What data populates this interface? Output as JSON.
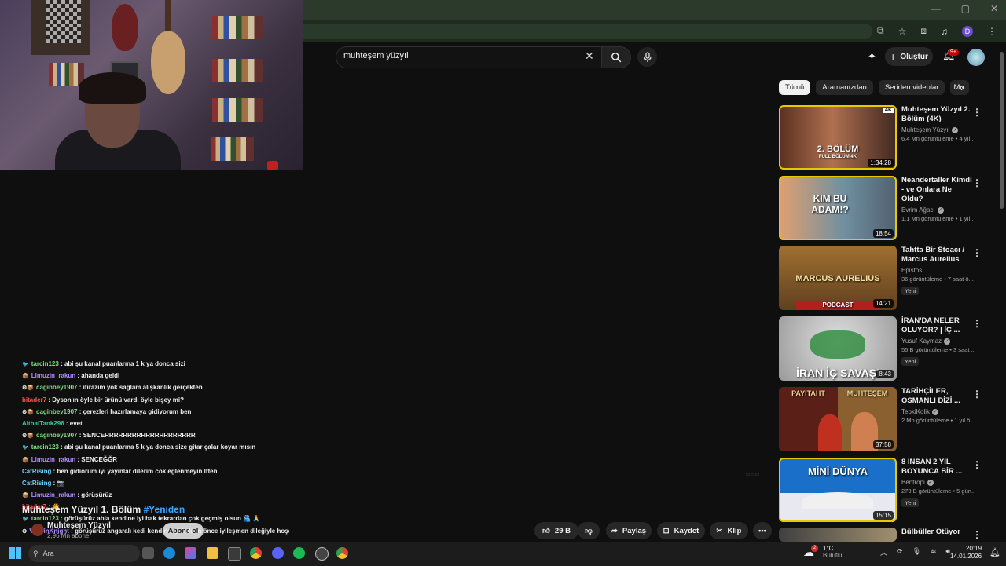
{
  "window": {
    "controls": [
      "—",
      "▢",
      "✕"
    ]
  },
  "browser": {
    "profile_letter": "D"
  },
  "youtube": {
    "search": {
      "query": "muhteşem yüzyıl"
    },
    "create_label": "Oluştur",
    "notif_badge": "9+",
    "chips": [
      "Tümü",
      "Aramanızdan",
      "Seriden videolar",
      "Mu"
    ],
    "recommendations": [
      {
        "title": "Muhteşem Yüzyıl 2. Bölüm (4K)",
        "channel": "Muhteşem Yüzyıl",
        "meta": "6,4 Mn görüntüleme • 4 yıl ...",
        "duration": "1:34:28",
        "thumb_text": "2. BÖLÜM",
        "thumb_sub": "FULL BÖLÜM 4K",
        "new": ""
      },
      {
        "title": "Neandertaller Kimdi - ve Onlara Ne Oldu?",
        "channel": "Evrim Ağacı",
        "meta": "1,1 Mn görüntüleme • 1 yıl ...",
        "duration": "18:54",
        "thumb_text": "KIM BU ADAM!?",
        "thumb_sub": "",
        "new": ""
      },
      {
        "title": "Tahtta Bir Stoacı / Marcus Aurelius",
        "channel": "Epistos",
        "meta": "36 görüntüleme • 7 saat ö...",
        "duration": "14:21",
        "thumb_text": "MARCUS AURELIUS",
        "thumb_sub": "PODCAST",
        "new": "Yeni"
      },
      {
        "title": "İRAN'DA NELER OLUYOR? | İÇ ...",
        "channel": "Yusuf Kaymaz",
        "meta": "55 B görüntüleme • 3 saat ...",
        "duration": "8:43",
        "thumb_text": "İRAN İÇ SAVAŞI",
        "thumb_sub": "",
        "new": "Yeni"
      },
      {
        "title": "TARİHÇİLER, OSMANLI DİZİ ...",
        "channel": "TepkiKolik",
        "meta": "2 Mn görüntüleme • 1 yıl ö...",
        "duration": "37:58",
        "thumb_text": "PAYITAHT",
        "thumb_sub": "MUHTEŞEM",
        "new": ""
      },
      {
        "title": "8 İNSAN 2 YIL BOYUNCA BİR ...",
        "channel": "Bentropi",
        "meta": "279 B görüntüleme • 5 gün...",
        "duration": "15:15",
        "thumb_text": "MİNİ DÜNYA",
        "thumb_sub": "",
        "new": "Yeni"
      },
      {
        "title": "Bülbüller Ötüyor",
        "channel": "",
        "meta": "",
        "duration": "",
        "thumb_text": "",
        "thumb_sub": "",
        "new": ""
      }
    ],
    "video": {
      "title_main": "Muhteşem Yüzyıl 1. Bölüm",
      "title_tag": "#Yeniden",
      "channel": "Muhteşem Yüzyıl",
      "subs": "2,96 Mn abone",
      "subscribe_label": "Abone ol",
      "likes": "29 B",
      "share_label": "Paylaş",
      "save_label": "Kaydet",
      "clip_label": "Klip"
    }
  },
  "chat": [
    {
      "user": "tarcin123",
      "color": "green",
      "emote": "🐦",
      "msg": "abi şu kanal puanlarına 1 k ya donca sizi"
    },
    {
      "user": "Limuzin_rakun",
      "color": "purple",
      "emote": "📦",
      "msg": "ahanda geldi"
    },
    {
      "user": "caginbey1907",
      "color": "green",
      "emote": "⚙📦",
      "msg": "itirazım yok sağlam alışkanlık gerçekten"
    },
    {
      "user": "bitader7",
      "color": "red",
      "emote": "",
      "msg": "Dyson'ın öyle bir ürünü vardı öyle bişey mi?"
    },
    {
      "user": "caginbey1907",
      "color": "green",
      "emote": "⚙📦",
      "msg": "çerezleri hazırlamaya gidiyorum ben"
    },
    {
      "user": "AlthaiTank296",
      "color": "teal",
      "emote": "",
      "msg": "evet"
    },
    {
      "user": "caginbey1907",
      "color": "green",
      "emote": "⚙📦",
      "msg": "SENCERRRRRRRRRRRRRRRRRRRR"
    },
    {
      "user": "tarcin123",
      "color": "green",
      "emote": "🐦",
      "msg": "abi şu kanal puanlarına 5 k ya donca size gitar çalar koyar mısın"
    },
    {
      "user": "Limuzin_rakun",
      "color": "purple",
      "emote": "📦",
      "msg": "SENCEĞĞR"
    },
    {
      "user": "CatRising",
      "color": "cyan",
      "emote": "",
      "msg": "ben gidiorum iyi yayinlar dilerim cok eglenmeyin ltfen"
    },
    {
      "user": "CatRising",
      "color": "cyan",
      "emote": "",
      "msg": "📷"
    },
    {
      "user": "Limuzin_rakun",
      "color": "purple",
      "emote": "📦",
      "msg": "görüşürüz"
    },
    {
      "user": "bitader7",
      "color": "red",
      "emote": "",
      "msg": "👋"
    },
    {
      "user": "tarcin123",
      "color": "green",
      "emote": "🐦",
      "msg": "görüşürüz abla kendine iyi bak tekrardan çok geçmiş olsun 🫂 🙏"
    },
    {
      "user": "VasilinKnight",
      "color": "purple",
      "emote": "⚙",
      "msg": "görüşürüz angaralı kedi kendine iyi bak en önce iyileşmen dileğiyle hoşçakal"
    }
  ],
  "taskbar": {
    "search_placeholder": "Ara",
    "weather_temp": "1°C",
    "weather_desc": "Bulutlu",
    "time": "20:19",
    "date": "14.01.2026",
    "weather_badge": "2"
  },
  "colors": {
    "accent": "#3ea6ff",
    "highlight_border": "#e8c800",
    "notif": "#cc0000"
  }
}
